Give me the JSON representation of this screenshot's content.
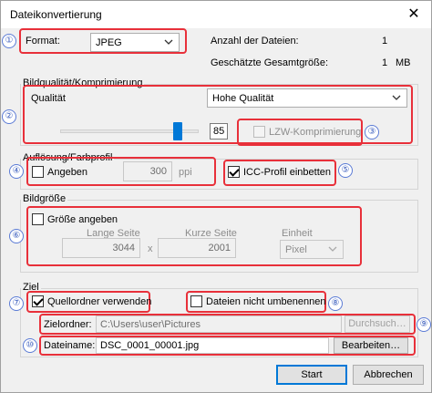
{
  "window": {
    "title": "Dateikonvertierung",
    "close_glyph": "✕"
  },
  "badges": [
    "①",
    "②",
    "③",
    "④",
    "⑤",
    "⑥",
    "⑦",
    "⑧",
    "⑨",
    "⑩"
  ],
  "format": {
    "label": "Format:",
    "value": "JPEG",
    "count_label": "Anzahl der Dateien:",
    "count_value": "1",
    "size_label": "Geschätzte Gesamtgröße:",
    "size_value": "1",
    "size_unit": "MB"
  },
  "quality": {
    "group_label": "Bildqualität/Komprimierung",
    "label": "Qualität",
    "value": "Hohe Qualität",
    "slider_value": "85",
    "slider_level": 0.85,
    "lzw_label": "LZW-Komprimierung"
  },
  "resolution": {
    "group_label": "Auflösung/Farbprofil",
    "specify_label": "Angeben",
    "dpi_value": "300",
    "dpi_unit": "ppi",
    "icc_label": "ICC-Profil einbetten"
  },
  "size": {
    "group_label": "Bildgröße",
    "specify_label": "Größe angeben",
    "long_label": "Lange Seite",
    "long_value": "3044",
    "times": "x",
    "short_label": "Kurze Seite",
    "short_value": "2001",
    "unit_label": "Einheit",
    "unit_value": "Pixel"
  },
  "target": {
    "group_label": "Ziel",
    "source_folder_label": "Quellordner verwenden",
    "no_rename_label": "Dateien nicht umbenennen",
    "folder_label": "Zielordner:",
    "folder_value": "C:\\Users\\user\\Pictures",
    "browse_label": "Durchsuch…",
    "filename_label": "Dateiname:",
    "filename_value": "DSC_0001_00001.jpg",
    "edit_label": "Bearbeiten…"
  },
  "footer": {
    "start_label": "Start",
    "cancel_label": "Abbrechen"
  },
  "colors": {
    "highlight": "#e8303a",
    "badge": "#3a5dbd",
    "accent": "#0078d7"
  }
}
